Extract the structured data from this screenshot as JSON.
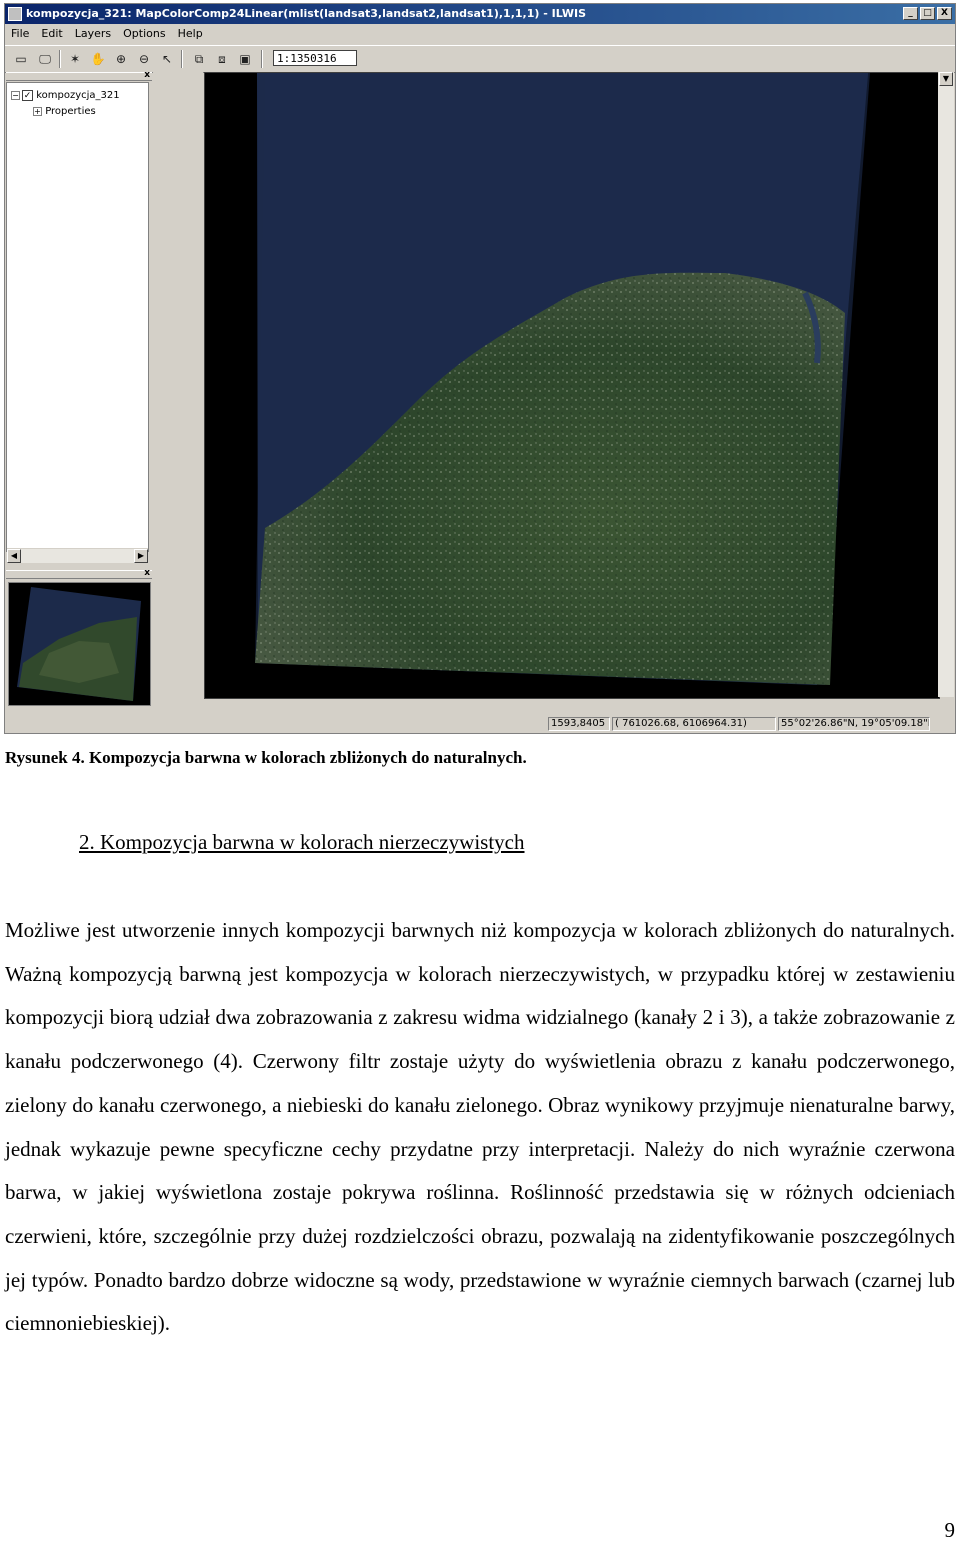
{
  "window": {
    "title": "kompozycja_321: MapColorComp24Linear(mlist(landsat3,landsat2,landsat1),1,1,1) - ILWIS",
    "minimize_label": "_",
    "maximize_label": "□",
    "close_label": "X"
  },
  "menu": {
    "items": [
      {
        "label": "File"
      },
      {
        "label": "Edit"
      },
      {
        "label": "Layers"
      },
      {
        "label": "Options"
      },
      {
        "label": "Help"
      }
    ]
  },
  "toolbar": {
    "scale_value": "1:1350316",
    "icons": [
      "entire-map-icon",
      "monitor-icon",
      "normal-pointer-icon",
      "pan-hand-icon",
      "zoom-in-icon",
      "zoom-out-icon",
      "select-arrow-icon",
      "add-layer-icon",
      "remove-layer-icon",
      "save-icon"
    ]
  },
  "layer_tree": {
    "items": [
      {
        "expander": "−",
        "checkbox": "✓",
        "label": "kompozycja_321"
      },
      {
        "expander": "+",
        "label": "Properties"
      }
    ],
    "close_label": "x"
  },
  "overview": {
    "close_label": "x"
  },
  "statusbar": {
    "rowcol": "1593,8405",
    "xy": "( 761026.68, 6106964.31)",
    "latlon": "55°02'26.86\"N, 19°05'09.18\"E"
  },
  "caption": "Rysunek 4. Kompozycja barwna w kolorach zbliżonych do naturalnych.",
  "section_heading": "2. Kompozycja barwna w kolorach nierzeczywistych",
  "body_text": "Możliwe jest utworzenie innych kompozycji barwnych niż kompozycja w kolorach zbliżonych do naturalnych. Ważną kompozycją barwną jest kompozycja w kolorach nierzeczywistych, w przypadku której w zestawieniu kompozycji biorą udział dwa zobrazowania z zakresu widma widzialnego (kanały 2 i 3), a także zobrazowanie z kanału podczerwonego (4). Czerwony filtr zostaje użyty do wyświetlenia obrazu z kanału podczerwonego, zielony do kanału czerwonego, a niebieski do kanału zielonego. Obraz wynikowy przyjmuje nienaturalne barwy, jednak wykazuje pewne specyficzne cechy przydatne przy interpretacji. Należy do nich wyraźnie czerwona barwa, w jakiej wyświetlona zostaje pokrywa roślinna. Roślinność przedstawia się w różnych odcieniach czerwieni, które, szczególnie przy dużej rozdzielczości obrazu, pozwalają na zidentyfikowanie poszczególnych jej typów. Ponadto bardzo dobrze widoczne są wody, przedstawione w wyraźnie ciemnych barwach (czarnej lub ciemnoniebieskiej).",
  "page_number": "9",
  "colors": {
    "titlebar": "#0a246a",
    "sea": "#1c2a4a",
    "land": "#2f4a2c"
  }
}
